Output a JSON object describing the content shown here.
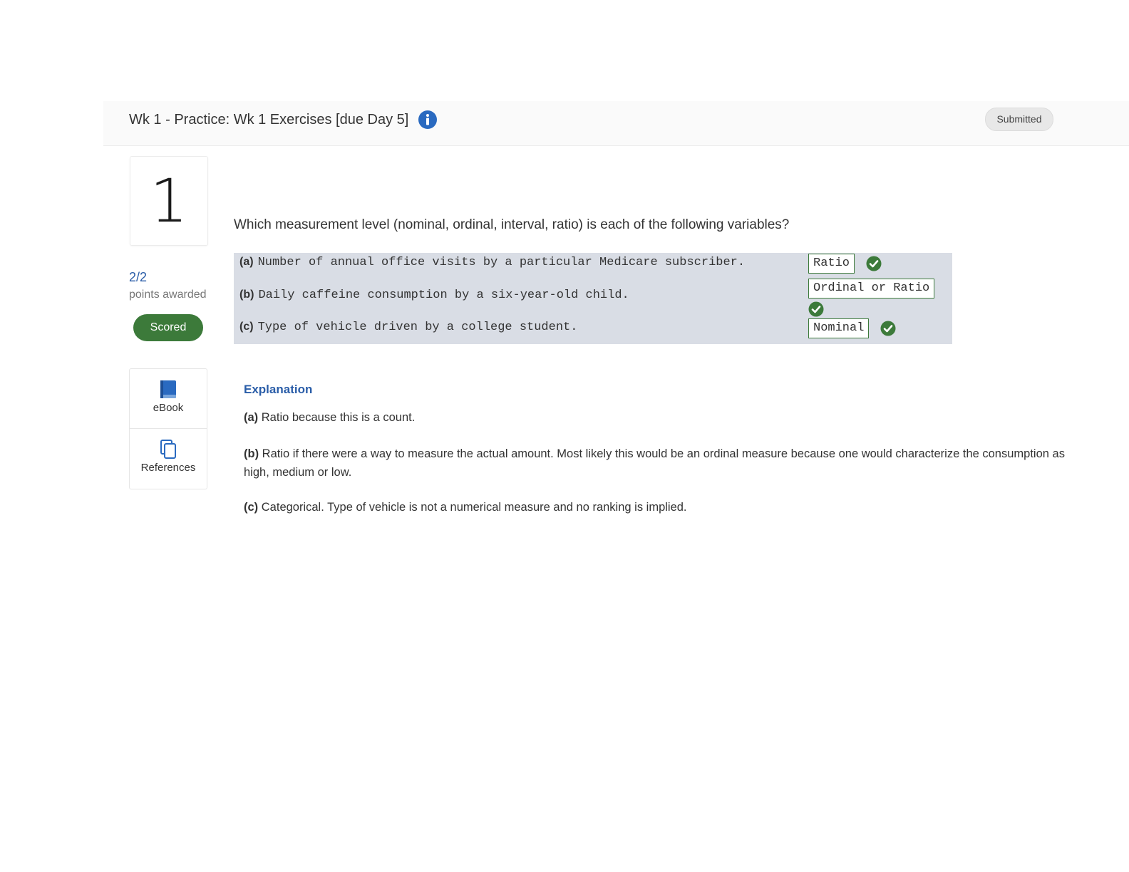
{
  "header": {
    "title": "Wk 1 - Practice: Wk 1 Exercises [due Day 5]",
    "info_icon": "info-circle-icon",
    "status": "Submitted"
  },
  "question": {
    "number": "1",
    "points": "2/2",
    "points_label": "points awarded",
    "scored_label": "Scored",
    "text": "Which measurement level (nominal, ordinal, interval, ratio) is each of the following variables?",
    "items": [
      {
        "label": "(a)",
        "text": "Number of annual office visits by a particular Medicare subscriber.",
        "answer": "Ratio",
        "status_icon": "check-circle-icon"
      },
      {
        "label": "(b)",
        "text": "Daily caffeine consumption by a six-year-old child.",
        "answer": "Ordinal or Ratio",
        "status_icon": "check-circle-icon"
      },
      {
        "label": "(c)",
        "text": "Type of vehicle driven by a college student.",
        "answer": "Nominal",
        "status_icon": "check-circle-icon"
      }
    ]
  },
  "resources": [
    {
      "label": "eBook",
      "icon": "book-icon"
    },
    {
      "label": "References",
      "icon": "copy-pages-icon"
    }
  ],
  "explanation": {
    "title": "Explanation",
    "items": [
      {
        "label": "(a)",
        "text": "Ratio because this is a count."
      },
      {
        "label": "(b)",
        "text": "Ratio if there were a way to measure the actual amount. Most likely this would be an ordinal measure because one would characterize the consumption as high, medium or low."
      },
      {
        "label": "(c)",
        "text": "Categorical. Type of vehicle is not a numerical measure and no ranking is implied."
      }
    ]
  },
  "colors": {
    "accent_blue": "#2a5da8",
    "success_green": "#3c7a3a",
    "table_bg": "#d9dde5"
  }
}
